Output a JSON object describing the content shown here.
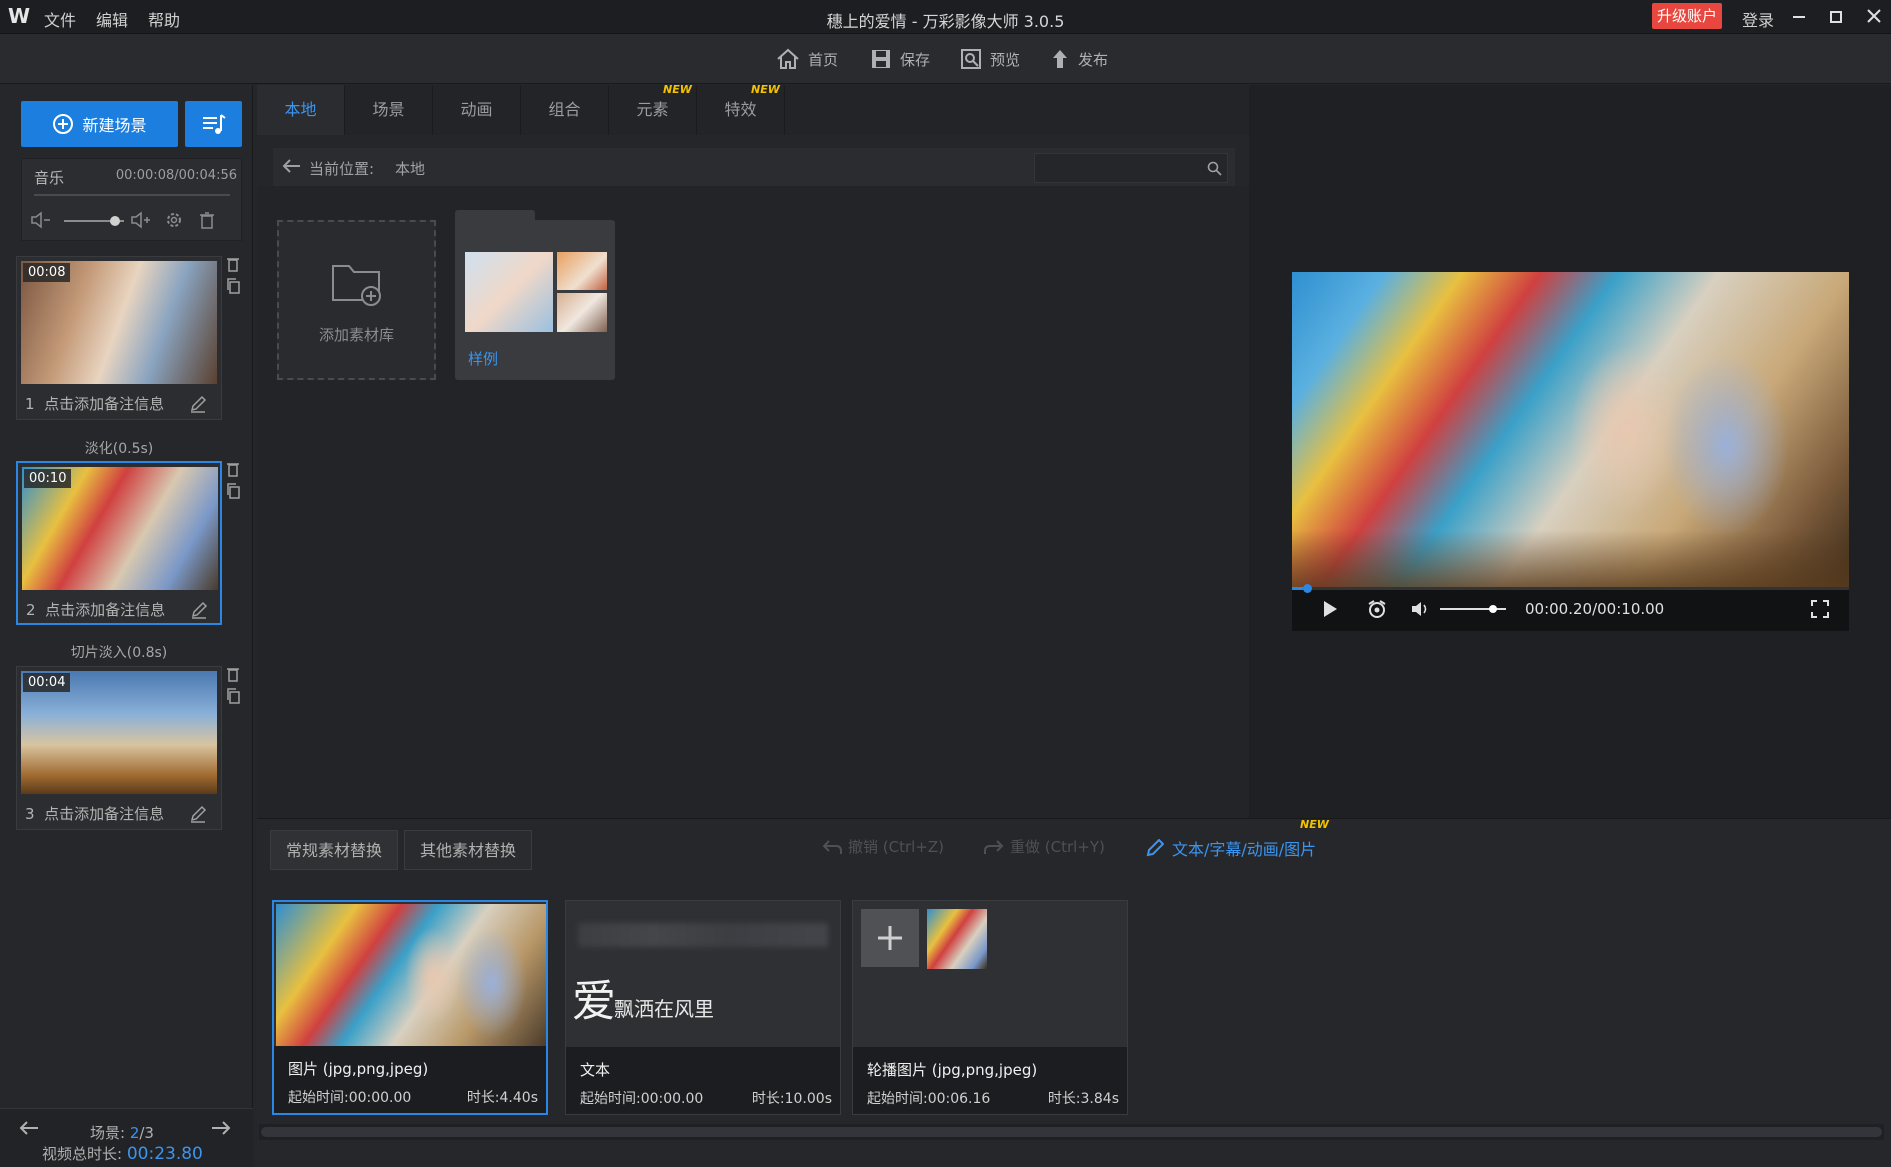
{
  "titlebar": {
    "logo": "W",
    "menu": [
      "文件",
      "编辑",
      "帮助"
    ],
    "title": "穗上的爱情 - 万彩影像大师 3.0.5",
    "upgrade_label": "升级账户",
    "login_label": "登录"
  },
  "toolbar": {
    "home": "首页",
    "save": "保存",
    "preview": "预览",
    "publish": "发布"
  },
  "left": {
    "new_scene_label": "新建场景",
    "music": {
      "label": "音乐",
      "time": "00:00:08/00:04:56",
      "volume_fraction": 0.85
    },
    "scenes": [
      {
        "index": "1",
        "time": "00:08",
        "note": "点击添加备注信息"
      },
      {
        "index": "2",
        "time": "00:10",
        "note": "点击添加备注信息",
        "selected": true
      },
      {
        "index": "3",
        "time": "00:04",
        "note": "点击添加备注信息"
      }
    ],
    "transitions": [
      "淡化(0.5s)",
      "切片淡入(0.8s)"
    ],
    "footer": {
      "scene_label": "场景: ",
      "scene_current": "2",
      "scene_total": "/3",
      "duration_label": "视频总时长: ",
      "duration_value": "00:23.80"
    }
  },
  "library": {
    "tabs": [
      {
        "label": "本地",
        "active": true,
        "new": false
      },
      {
        "label": "场景",
        "active": false,
        "new": false
      },
      {
        "label": "动画",
        "active": false,
        "new": false
      },
      {
        "label": "组合",
        "active": false,
        "new": false
      },
      {
        "label": "元素",
        "active": false,
        "new": true
      },
      {
        "label": "特效",
        "active": false,
        "new": true
      }
    ],
    "new_badge": "NEW",
    "breadcrumb_label": "当前位置:",
    "breadcrumb_value": "本地",
    "search_placeholder": "",
    "add_library_label": "添加素材库",
    "sample_label": "样例"
  },
  "preview": {
    "time": "00:00.20/00:10.00",
    "progress_fraction": 0.02,
    "volume_fraction": 0.8
  },
  "bottom": {
    "tabs": [
      "常规素材替换",
      "其他素材替换"
    ],
    "undo": "撤销 (Ctrl+Z)",
    "redo": "重做 (Ctrl+Y)",
    "text_edit": "文本/字幕/动画/图片",
    "text_edit_new": "NEW",
    "cards": [
      {
        "title": "图片 (jpg,png,jpeg)",
        "start": "起始时间:00:00.00",
        "duration": "时长:4.40s"
      },
      {
        "title": "文本",
        "start": "起始时间:00:00.00",
        "duration": "时长:10.00s",
        "big_char": "爱",
        "text": "飘洒在风里"
      },
      {
        "title": "轮播图片 (jpg,png,jpeg)",
        "start": "起始时间:00:06.16",
        "duration": "时长:3.84s"
      }
    ]
  },
  "colors": {
    "accent": "#1c7fe0",
    "upgrade": "#e8473f",
    "new_badge": "#f2c200"
  }
}
